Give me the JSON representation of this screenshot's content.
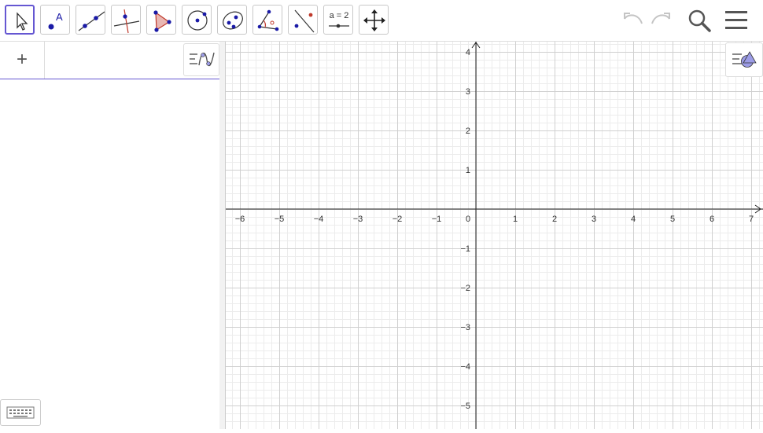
{
  "toolbar": {
    "slider_tool_label": "a = 2"
  },
  "algebra": {
    "add_label": "+"
  },
  "axes": {
    "x_ticks": [
      "−6",
      "−5",
      "−4",
      "−3",
      "−2",
      "−1",
      "0",
      "1",
      "2",
      "3",
      "4",
      "5",
      "6",
      "7"
    ],
    "y_ticks": [
      "4",
      "3",
      "2",
      "1",
      "−1",
      "−2",
      "−3",
      "−4",
      "−5"
    ]
  },
  "colors": {
    "accent": "#6557d2",
    "point": "#1a1aa6",
    "grid_major": "#d0d0d0",
    "grid_minor": "#ececec"
  }
}
